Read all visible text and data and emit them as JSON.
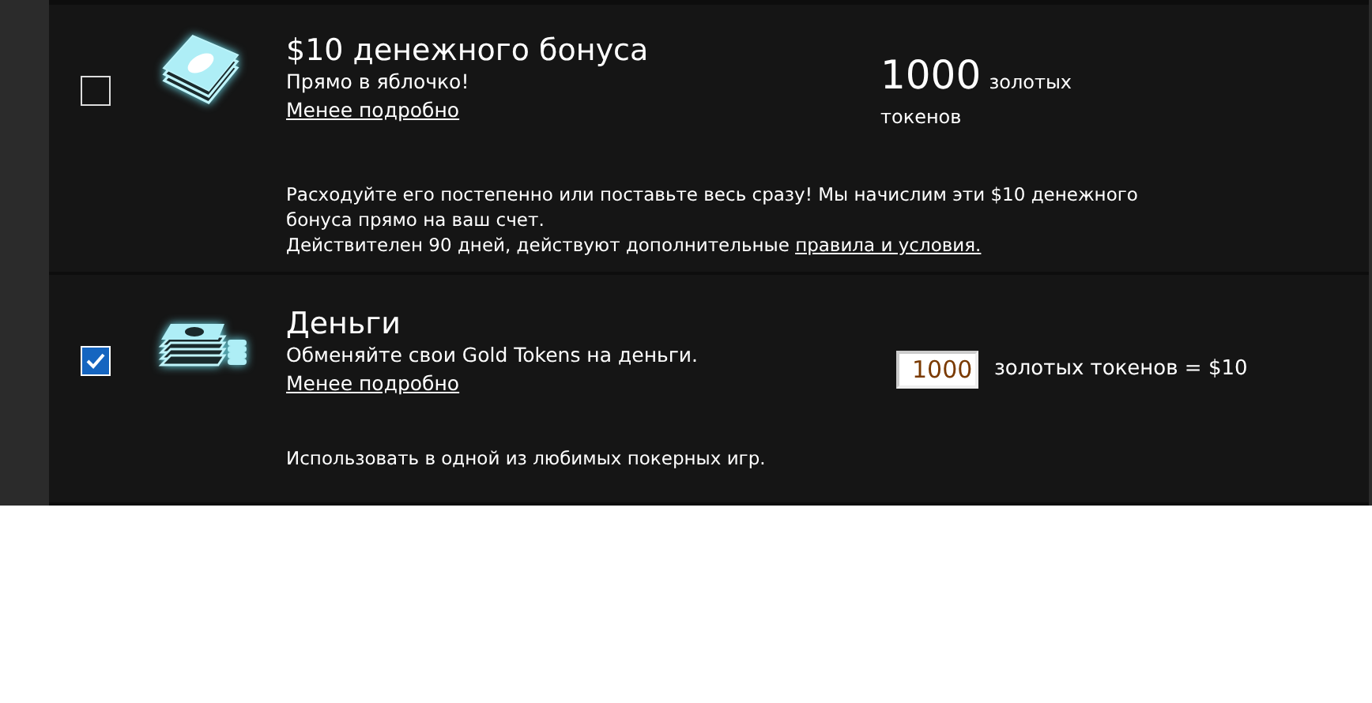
{
  "offers": [
    {
      "kind": "amount",
      "checked": false,
      "title": "$10 денежного бонуса",
      "subtitle": "Прямо в яблочко!",
      "toggle_link": "Менее подробно",
      "amount": "1000",
      "amount_unit": "золотых",
      "amount_unit_2": "токенов",
      "description": "Расходуйте его постепенно или поставьте весь сразу! Мы начислим эти $10 денежного бонуса прямо на ваш счет.",
      "note": "Действителен 90 дней, действуют дополнительные",
      "note_link": "правила и условия."
    },
    {
      "kind": "exchange",
      "checked": true,
      "title": "Деньги",
      "subtitle": "Обменяйте свои Gold Tokens на деньги.",
      "toggle_link": "Менее подробно",
      "tokens_value": "1000",
      "rate": "золотых токенов = $10",
      "description": "Использовать в одной из любимых покерных игр."
    }
  ]
}
